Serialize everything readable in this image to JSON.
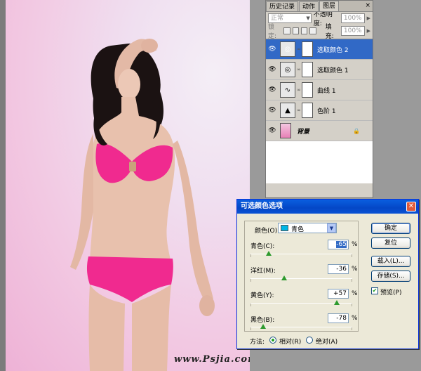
{
  "panel": {
    "tabs": [
      "历史记录",
      "动作",
      "图层"
    ],
    "close": "×",
    "blend_mode": "正常",
    "opacity_label": "不透明度:",
    "opacity_value": "100%",
    "lock_label": "锁定:",
    "fill_label": "填充:",
    "fill_value": "100%",
    "layers": [
      {
        "name": "选取颜色 2",
        "active": true
      },
      {
        "name": "选取颜色 1",
        "active": false
      },
      {
        "name": "曲线 1",
        "active": false
      },
      {
        "name": "色阶 1",
        "active": false
      }
    ],
    "background_layer": "背景"
  },
  "dialog": {
    "title": "可选颜色选项",
    "color_label": "颜色(O):",
    "color_value": "青色",
    "sliders": [
      {
        "label": "青色(C):",
        "value": "-65",
        "pct": "%"
      },
      {
        "label": "洋红(M):",
        "value": "-36",
        "pct": "%"
      },
      {
        "label": "黄色(Y):",
        "value": "+57",
        "pct": "%"
      },
      {
        "label": "黑色(B):",
        "value": "-78",
        "pct": "%"
      }
    ],
    "method_label": "方法:",
    "radio_relative": "相对(R)",
    "radio_absolute": "绝对(A)",
    "buttons": {
      "ok": "确定",
      "reset": "复位",
      "load": "载入(L)...",
      "save": "存储(S)..."
    },
    "preview_label": "预览(P)"
  },
  "watermark": "www.Psjia.com",
  "colors": {
    "selected_layer": "#3169c6",
    "swatch_cyan": "#00b6e6",
    "title_bar": "#0a52d4"
  }
}
